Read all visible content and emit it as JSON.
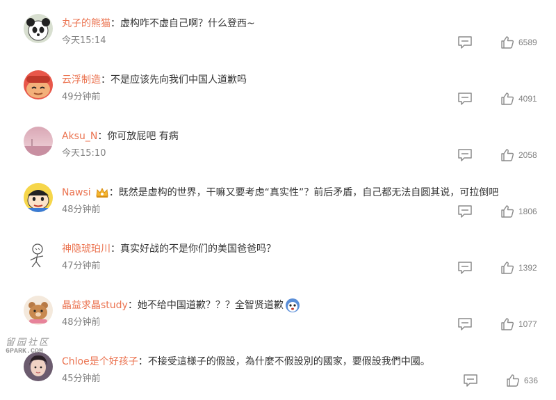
{
  "comments": [
    {
      "user": "丸子的熊猫",
      "colon": "：",
      "text": "虚构咋不虚自己啊？什么登西~",
      "time": "今天15:14",
      "likes": "6589",
      "avatar_icon": "panda-avatar-icon"
    },
    {
      "user": "云浮制造",
      "colon": "：",
      "text": "不是应该先向我们中国人道歉吗",
      "time": "49分钟前",
      "likes": "4091",
      "avatar_icon": "cartoon-face-avatar-icon"
    },
    {
      "user": "Aksu_N",
      "colon": "：",
      "text": "你可放屁吧 有病",
      "time": "今天15:10",
      "likes": "2058",
      "avatar_icon": "pink-sky-avatar-icon"
    },
    {
      "user": "Nawsi",
      "colon": "：",
      "text": "既然是虚构的世界，干嘛又要考虑“真实性”？前后矛盾，自己都无法自圆其说，可拉倒吧",
      "time": "48分钟前",
      "likes": "1806",
      "avatar_icon": "crayon-shin-avatar-icon",
      "badge_icon": "crown-badge-icon"
    },
    {
      "user": "神隐琥珀川",
      "colon": "：",
      "text": "真实好战的不是你们的美国爸爸吗？",
      "time": "47分钟前",
      "likes": "1392",
      "avatar_icon": "sketch-figure-avatar-icon"
    },
    {
      "user": "晶益求晶study",
      "colon": "：",
      "text": "她不给中国道歉？？？全智贤道歉",
      "time": "48分钟前",
      "likes": "1077",
      "avatar_icon": "bear-avatar-icon",
      "emoji_icon": "blue-face-emoji-icon"
    },
    {
      "user": "Chloe是个好孩子",
      "colon": "：",
      "text": "不接受這様子的假設，為什麼不假設別的國家，要假設我們中國。",
      "time": "45分钟前",
      "likes": "636",
      "avatar_icon": "girl-photo-avatar-icon"
    }
  ],
  "watermark": {
    "cn": "留园社区",
    "en": "6PARK.COM"
  },
  "icons": {
    "reply": "comment-icon",
    "like": "thumbs-up-icon"
  },
  "colors": {
    "username": "#eb7350",
    "text": "#333333",
    "meta": "#808080"
  }
}
